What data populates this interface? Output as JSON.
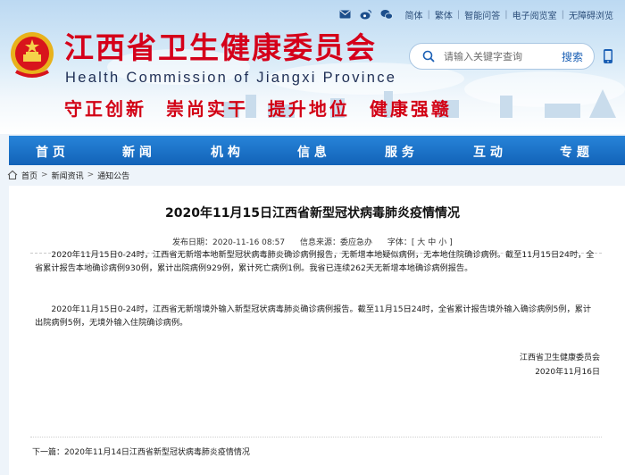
{
  "header": {
    "title": "江西省卫生健康委员会",
    "subtitle": "Health Commission of Jiangxi Province",
    "slogans": [
      "守正创新",
      "崇尚实干",
      "提升地位",
      "健康强赣"
    ],
    "top_links": [
      "简体",
      "繁体",
      "智能问答",
      "电子阅览室",
      "无障碍浏览"
    ]
  },
  "search": {
    "placeholder": "请输入关键字查询",
    "button": "搜索"
  },
  "nav": {
    "items": [
      "首 页",
      "新 闻",
      "机 构",
      "信 息",
      "服 务",
      "互 动",
      "专 题"
    ]
  },
  "breadcrumb": {
    "items": [
      "首页",
      "新闻资讯",
      "通知公告"
    ]
  },
  "article": {
    "title": "2020年11月15日江西省新型冠状病毒肺炎疫情情况",
    "publish_time": "发布日期：2020-11-16 08:57",
    "source": "信息来源：委应急办",
    "font_label": "字体：",
    "font_sizes": [
      "[ 大",
      "中",
      "小 ]"
    ],
    "paragraphs": [
      "2020年11月15日0-24时，江西省无新增本地新型冠状病毒肺炎确诊病例报告，无新增本地疑似病例，无本地住院确诊病例。截至11月15日24时，全省累计报告本地确诊病例930例，累计出院病例929例，累计死亡病例1例。我省已连续262天无新增本地确诊病例报告。",
      "2020年11月15日0-24时，江西省无新增境外输入新型冠状病毒肺炎确诊病例报告。截至11月15日24时，全省累计报告境外输入确诊病例5例，累计出院病例5例，无境外输入住院确诊病例。"
    ],
    "signature_org": "江西省卫生健康委员会",
    "signature_date": "2020年11月16日",
    "prev_label": "下一篇：",
    "prev_title": "2020年11月14日江西省新型冠状病毒肺炎疫情情况"
  },
  "colors": {
    "brand_red": "#d5001a",
    "nav_blue": "#1a6fc6"
  }
}
